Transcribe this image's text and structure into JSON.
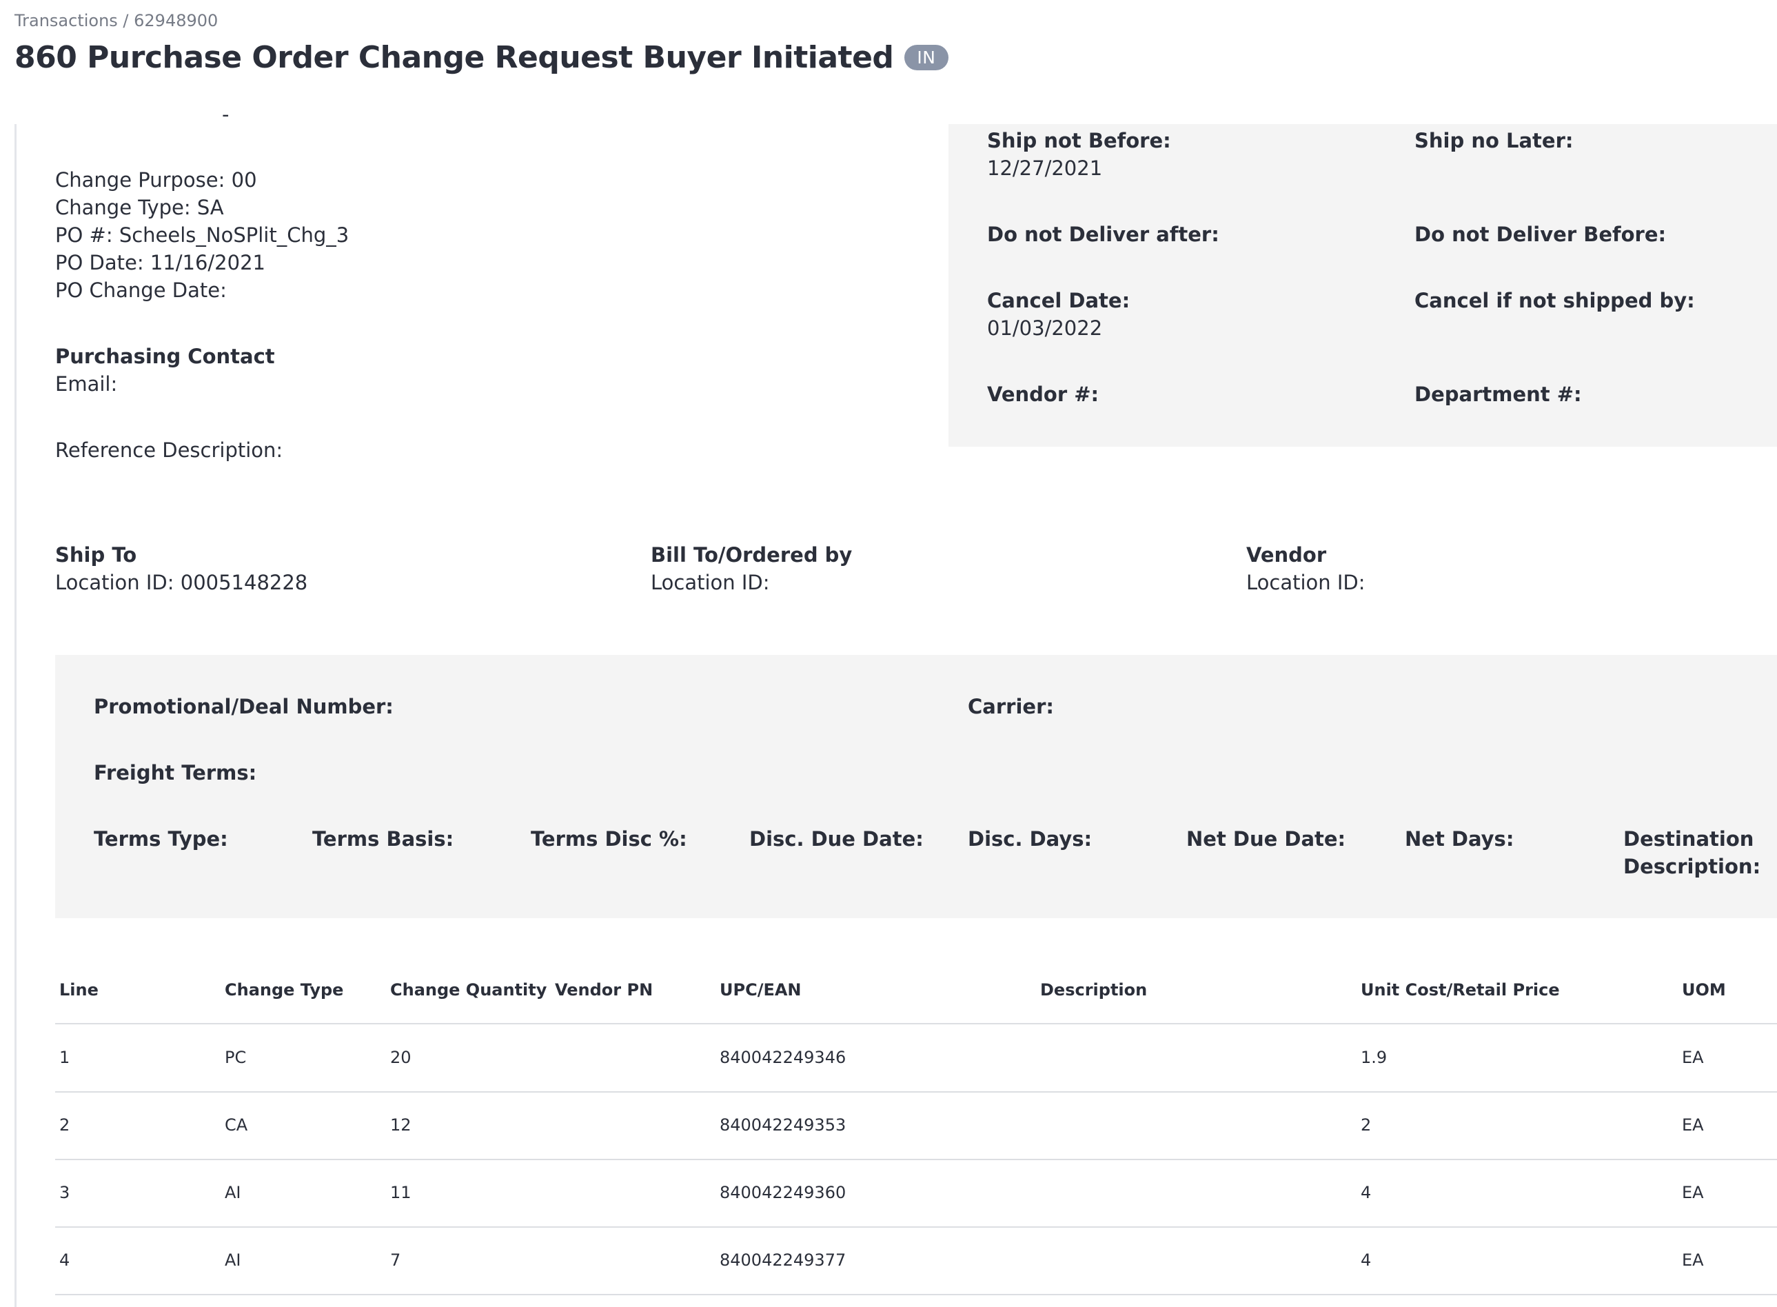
{
  "breadcrumb": "Transactions / 62948900",
  "title": "860 Purchase Order Change Request Buyer Initiated",
  "badge": "IN",
  "header_info": {
    "truncated_dash": "-",
    "change_purpose": "Change Purpose: 00",
    "change_type": "Change Type: SA",
    "po_number": "PO #: Scheels_NoSPlit_Chg_3",
    "po_date": "PO Date: 11/16/2021",
    "po_change_date": "PO Change Date:",
    "purchasing_contact_label": "Purchasing Contact",
    "email": "Email:",
    "reference_description": "Reference Description:"
  },
  "dates": {
    "ship_not_before_label": "Ship not Before:",
    "ship_not_before_value": "12/27/2021",
    "ship_no_later_label": "Ship no Later:",
    "do_not_deliver_after_label": "Do not Deliver after:",
    "do_not_deliver_before_label": "Do not Deliver Before:",
    "cancel_date_label": "Cancel Date:",
    "cancel_date_value": "01/03/2022",
    "cancel_if_not_shipped_label": "Cancel if not shipped by:",
    "vendor_number_label": "Vendor #:",
    "department_number_label": "Department #:"
  },
  "parties": {
    "ship_to_label": "Ship To",
    "ship_to_location": "Location ID: 0005148228",
    "bill_to_label": "Bill To/Ordered by",
    "bill_to_location": "Location ID:",
    "vendor_label": "Vendor",
    "vendor_location": "Location ID:"
  },
  "terms": {
    "promo_label": "Promotional/Deal Number:",
    "carrier_label": "Carrier:",
    "freight_terms_label": "Freight Terms:",
    "terms_type": "Terms Type:",
    "terms_basis": "Terms Basis:",
    "terms_disc_pct": "Terms Disc %:",
    "disc_due_date": "Disc. Due Date:",
    "disc_days": "Disc. Days:",
    "net_due_date": "Net Due Date:",
    "net_days": "Net Days:",
    "destination_line1": "Destination",
    "destination_line2": "Description:"
  },
  "table": {
    "headers": [
      "Line",
      "Change Type",
      "Change Quantity",
      "Vendor PN",
      "UPC/EAN",
      "Description",
      "Unit Cost/Retail Price",
      "UOM"
    ],
    "rows": [
      [
        "1",
        "PC",
        "20",
        "",
        "840042249346",
        "",
        "1.9",
        "EA"
      ],
      [
        "2",
        "CA",
        "12",
        "",
        "840042249353",
        "",
        "2",
        "EA"
      ],
      [
        "3",
        "AI",
        "11",
        "",
        "840042249360",
        "",
        "4",
        "EA"
      ],
      [
        "4",
        "AI",
        "7",
        "",
        "840042249377",
        "",
        "4",
        "EA"
      ]
    ]
  }
}
